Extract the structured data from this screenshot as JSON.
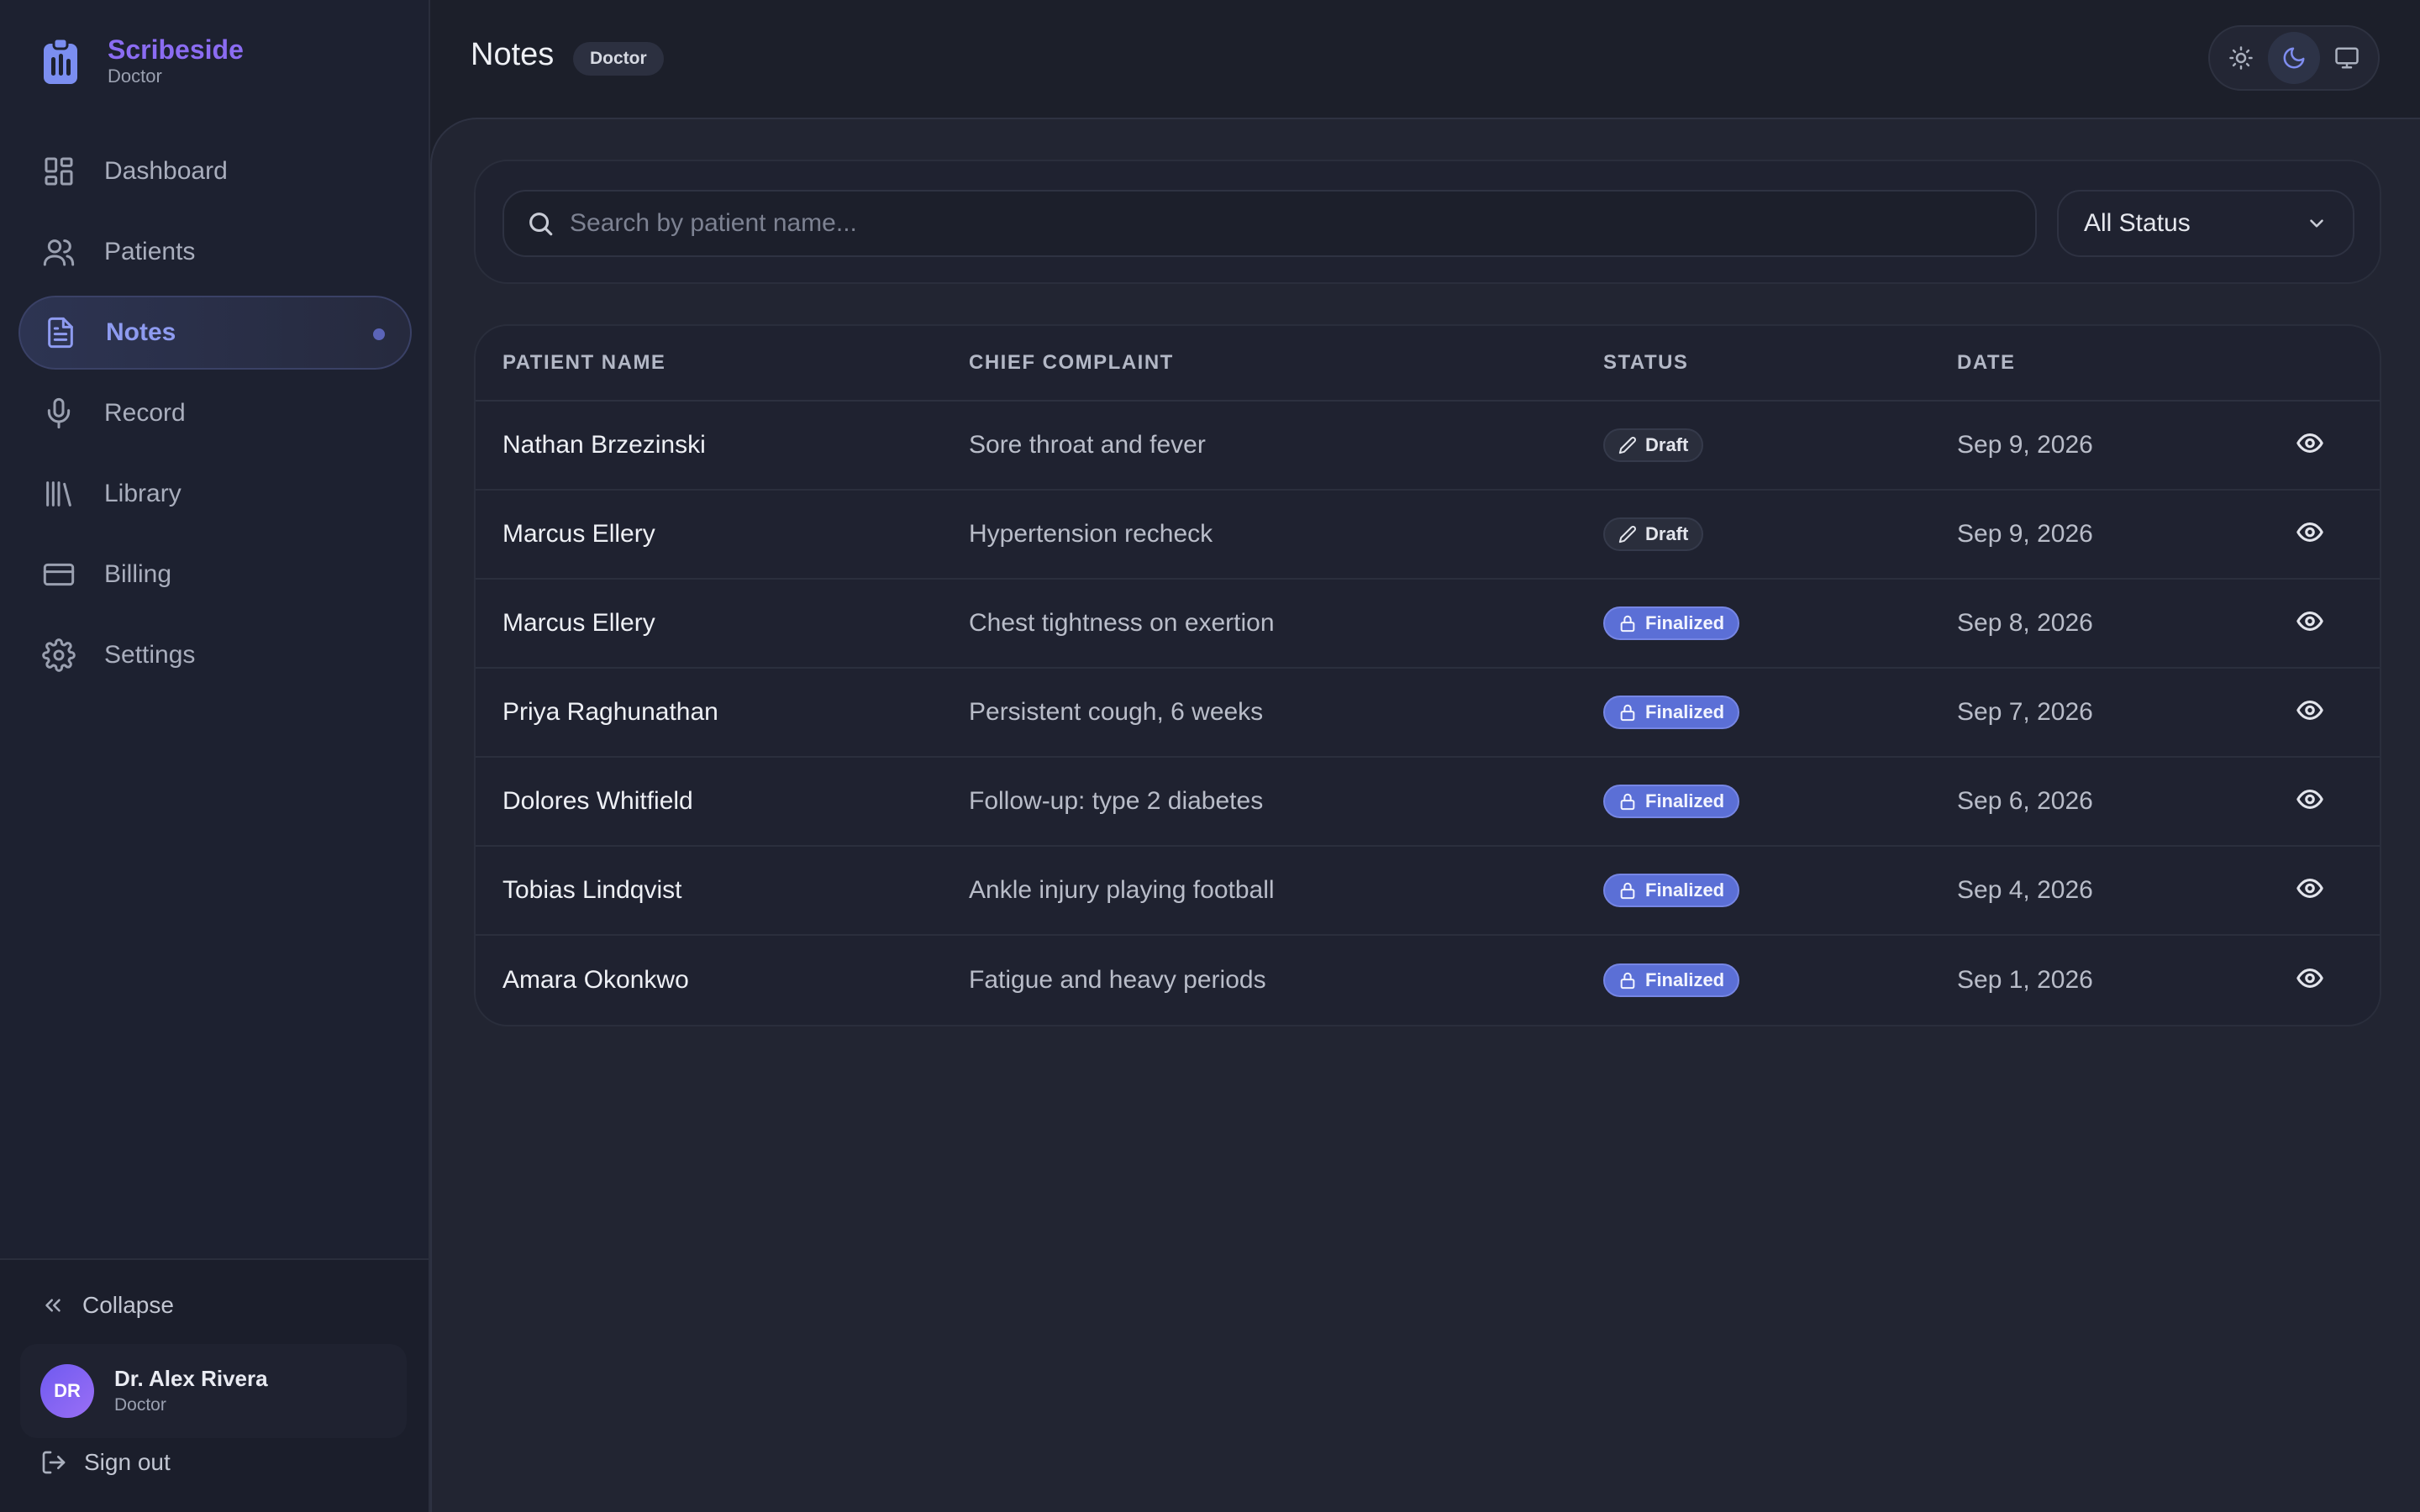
{
  "brand": {
    "name": "Scribeside",
    "subtitle": "Doctor"
  },
  "sidebar": {
    "items": [
      {
        "label": "Dashboard",
        "icon": "dashboard-icon",
        "active": false
      },
      {
        "label": "Patients",
        "icon": "users-icon",
        "active": false
      },
      {
        "label": "Notes",
        "icon": "file-text-icon",
        "active": true
      },
      {
        "label": "Record",
        "icon": "microphone-icon",
        "active": false
      },
      {
        "label": "Library",
        "icon": "library-icon",
        "active": false
      },
      {
        "label": "Billing",
        "icon": "credit-card-icon",
        "active": false
      },
      {
        "label": "Settings",
        "icon": "gear-icon",
        "active": false
      }
    ],
    "collapse_label": "Collapse",
    "user": {
      "initials": "DR",
      "name": "Dr. Alex Rivera",
      "role": "Doctor"
    },
    "signout_label": "Sign out"
  },
  "header": {
    "title": "Notes",
    "role_badge": "Doctor",
    "theme_options": [
      "light",
      "dark",
      "system"
    ],
    "theme_selected": "dark"
  },
  "filters": {
    "search_placeholder": "Search by patient name...",
    "search_value": "",
    "status_selected": "All Status"
  },
  "table": {
    "columns": [
      "PATIENT NAME",
      "CHIEF COMPLAINT",
      "STATUS",
      "DATE"
    ],
    "rows": [
      {
        "patient": "Nathan Brzezinski",
        "complaint": "Sore throat and fever",
        "status": "Draft",
        "date": "Sep 9, 2026"
      },
      {
        "patient": "Marcus Ellery",
        "complaint": "Hypertension recheck",
        "status": "Draft",
        "date": "Sep 9, 2026"
      },
      {
        "patient": "Marcus Ellery",
        "complaint": "Chest tightness on exertion",
        "status": "Finalized",
        "date": "Sep 8, 2026"
      },
      {
        "patient": "Priya Raghunathan",
        "complaint": "Persistent cough, 6 weeks",
        "status": "Finalized",
        "date": "Sep 7, 2026"
      },
      {
        "patient": "Dolores Whitfield",
        "complaint": "Follow-up: type 2 diabetes",
        "status": "Finalized",
        "date": "Sep 6, 2026"
      },
      {
        "patient": "Tobias Lindqvist",
        "complaint": "Ankle injury playing football",
        "status": "Finalized",
        "date": "Sep 4, 2026"
      },
      {
        "patient": "Amara Okonkwo",
        "complaint": "Fatigue and heavy periods",
        "status": "Finalized",
        "date": "Sep 1, 2026"
      }
    ]
  },
  "colors": {
    "accent": "#8b6cf2",
    "active_nav": "#8e9bf0",
    "finalized_badge": "#5b6fd6",
    "background": "#1c1f2a"
  }
}
